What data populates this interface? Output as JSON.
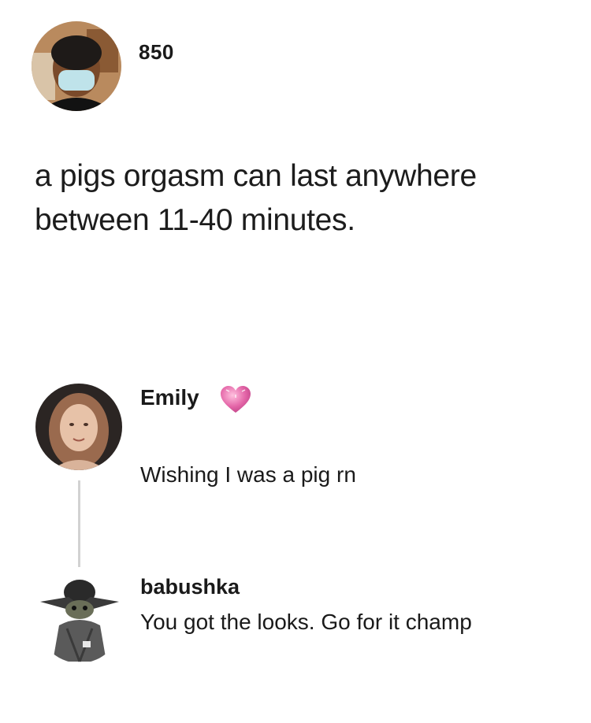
{
  "post": {
    "username": "850",
    "text": "a pigs orgasm can last anywhere between 11-40 minutes."
  },
  "comments": [
    {
      "name": "Emily",
      "badge_icon": "pink-heart-icon",
      "text": "Wishing I was a pig rn"
    },
    {
      "name": "babushka",
      "text": "You got the looks. Go for it champ"
    }
  ],
  "colors": {
    "background": "#ffffff",
    "text": "#1a1a1a",
    "heart": "#e05a9a",
    "thread_line": "#d2d2d2"
  }
}
